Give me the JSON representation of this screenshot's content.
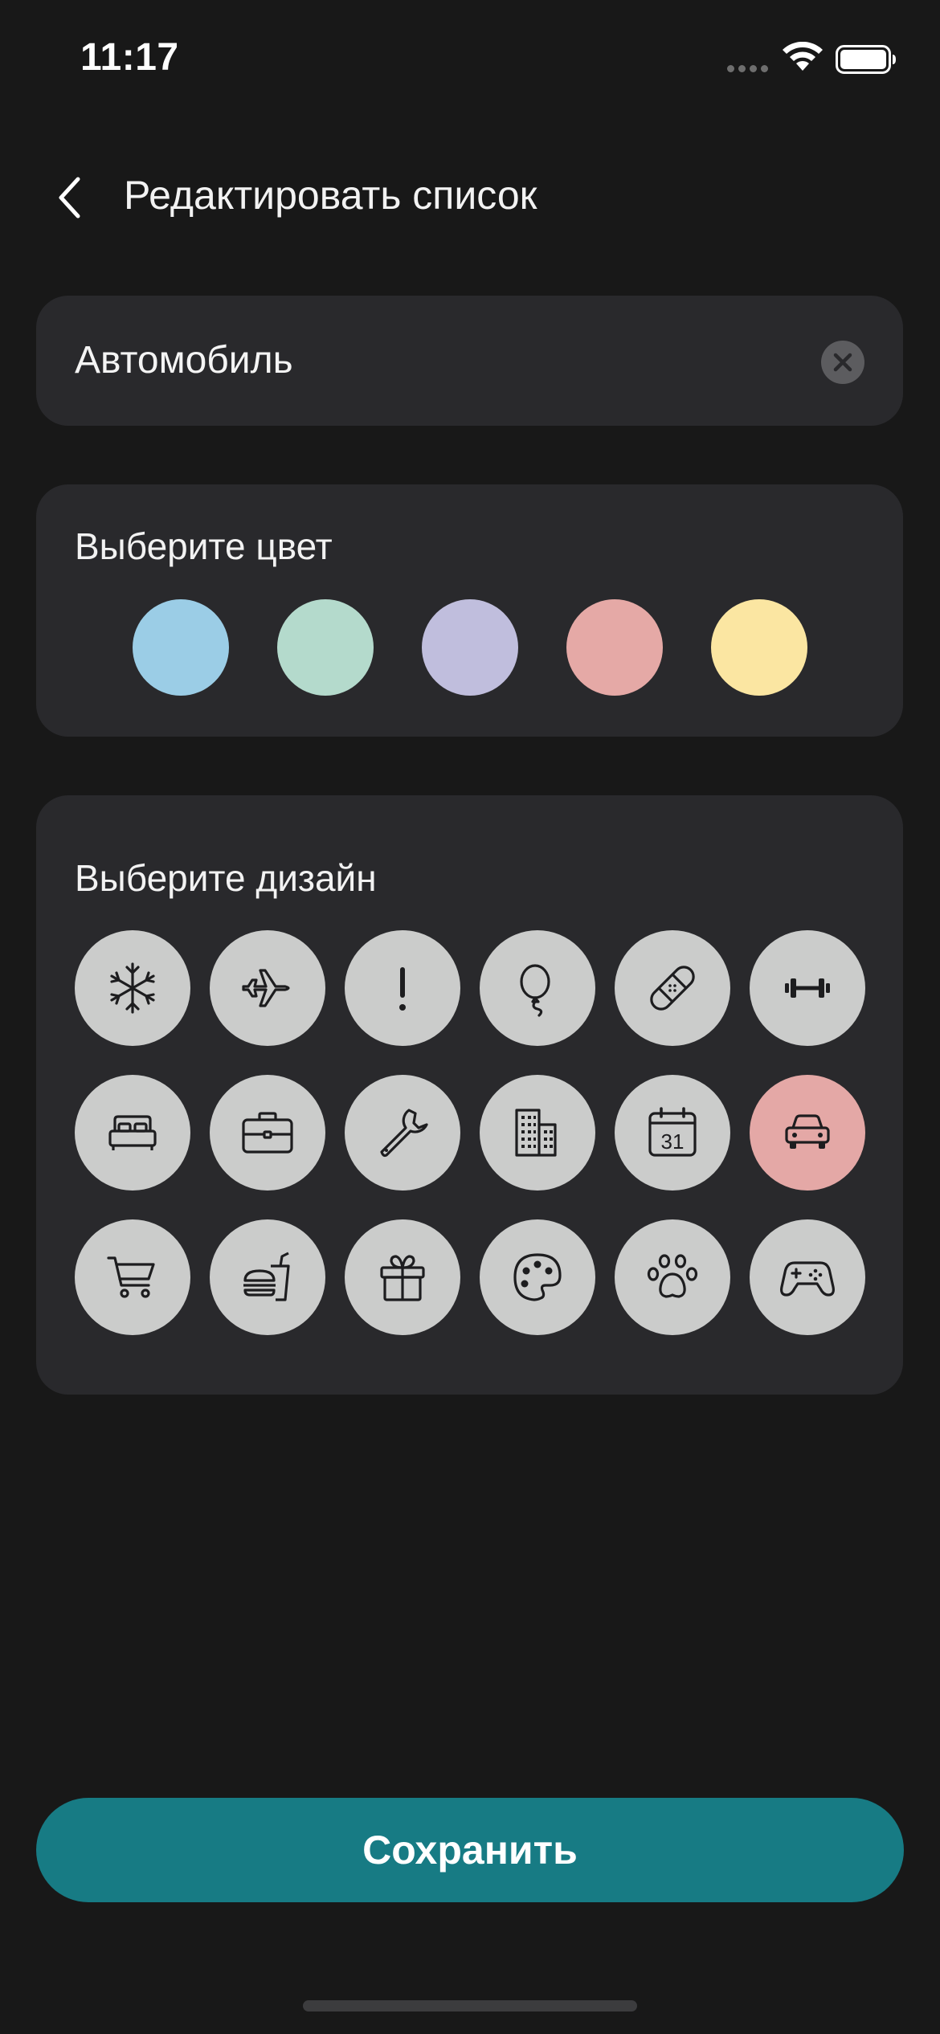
{
  "status_bar": {
    "time": "11:17"
  },
  "header": {
    "title": "Редактировать список"
  },
  "name_field": {
    "value": "Автомобиль"
  },
  "color_section": {
    "label": "Выберите цвет",
    "colors": [
      "#9bcde6",
      "#b4dacc",
      "#c0bedd",
      "#e5a9a6",
      "#fbe6a2"
    ]
  },
  "design_section": {
    "label": "Выберите дизайн",
    "icons": [
      [
        "snowflake-icon",
        "airplane-icon",
        "exclamation-icon",
        "balloon-icon",
        "bandage-icon",
        "dumbbell-icon"
      ],
      [
        "bed-icon",
        "briefcase-icon",
        "wrench-icon",
        "building-icon",
        "calendar-icon",
        "car-icon"
      ],
      [
        "shopping-cart-icon",
        "fast-food-icon",
        "gift-icon",
        "palette-icon",
        "paw-icon",
        "gamepad-icon"
      ]
    ],
    "selected": "car-icon",
    "selected_color": "#e4a8a6",
    "calendar_day": "31"
  },
  "save_button": {
    "label": "Сохранить",
    "color": "#177b84"
  }
}
